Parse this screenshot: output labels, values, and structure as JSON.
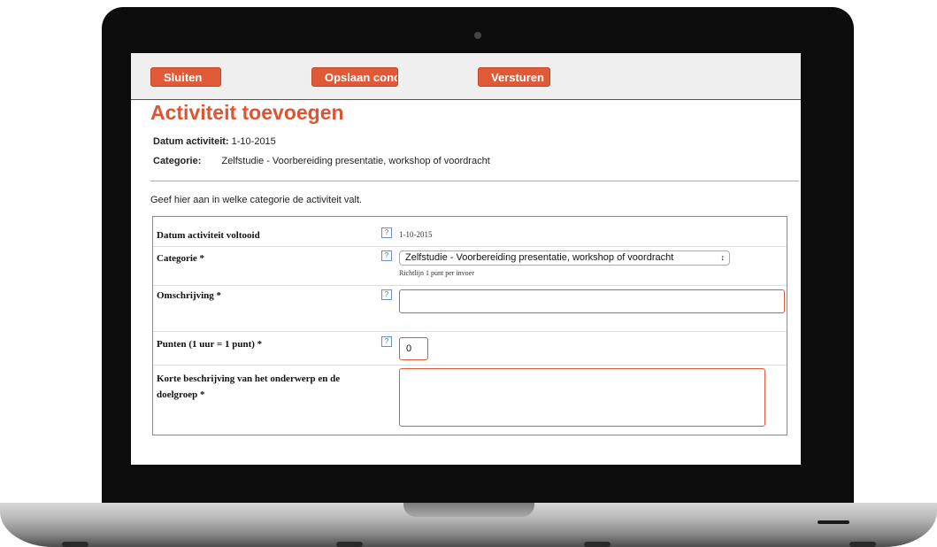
{
  "toolbar": {
    "close_label": "Sluiten",
    "save_draft_label": "Opslaan conc",
    "submit_label": "Versturen"
  },
  "page": {
    "title": "Activiteit toevoegen",
    "date_label": "Datum activiteit:",
    "date_value": "1-10-2015",
    "category_label": "Categorie:",
    "category_value": "Zelfstudie - Voorbereiding presentatie, workshop of voordracht",
    "intro": "Geef hier aan in welke categorie de activiteit valt."
  },
  "form": {
    "help_glyph": "?",
    "date_completed": {
      "label": "Datum activiteit voltooid",
      "value": "1-10-2015"
    },
    "category": {
      "label": "Categorie *",
      "selected": "Zelfstudie - Voorbereiding presentatie, workshop of voordracht",
      "hint": "Richtlijn 1 punt per invoer"
    },
    "description": {
      "label": "Omschrijving *",
      "value": ""
    },
    "points": {
      "label": "Punten (1 uur = 1 punt) *",
      "value": "0"
    },
    "short_description": {
      "label_line1": "Korte beschrijving van het onderwerp en de",
      "label_line2": "doelgroep *",
      "value": ""
    }
  },
  "colors": {
    "accent": "#e15a38",
    "title": "#dd5533"
  },
  "icons": {
    "help": "question-icon",
    "select_arrow": "up-down-arrow-icon"
  }
}
